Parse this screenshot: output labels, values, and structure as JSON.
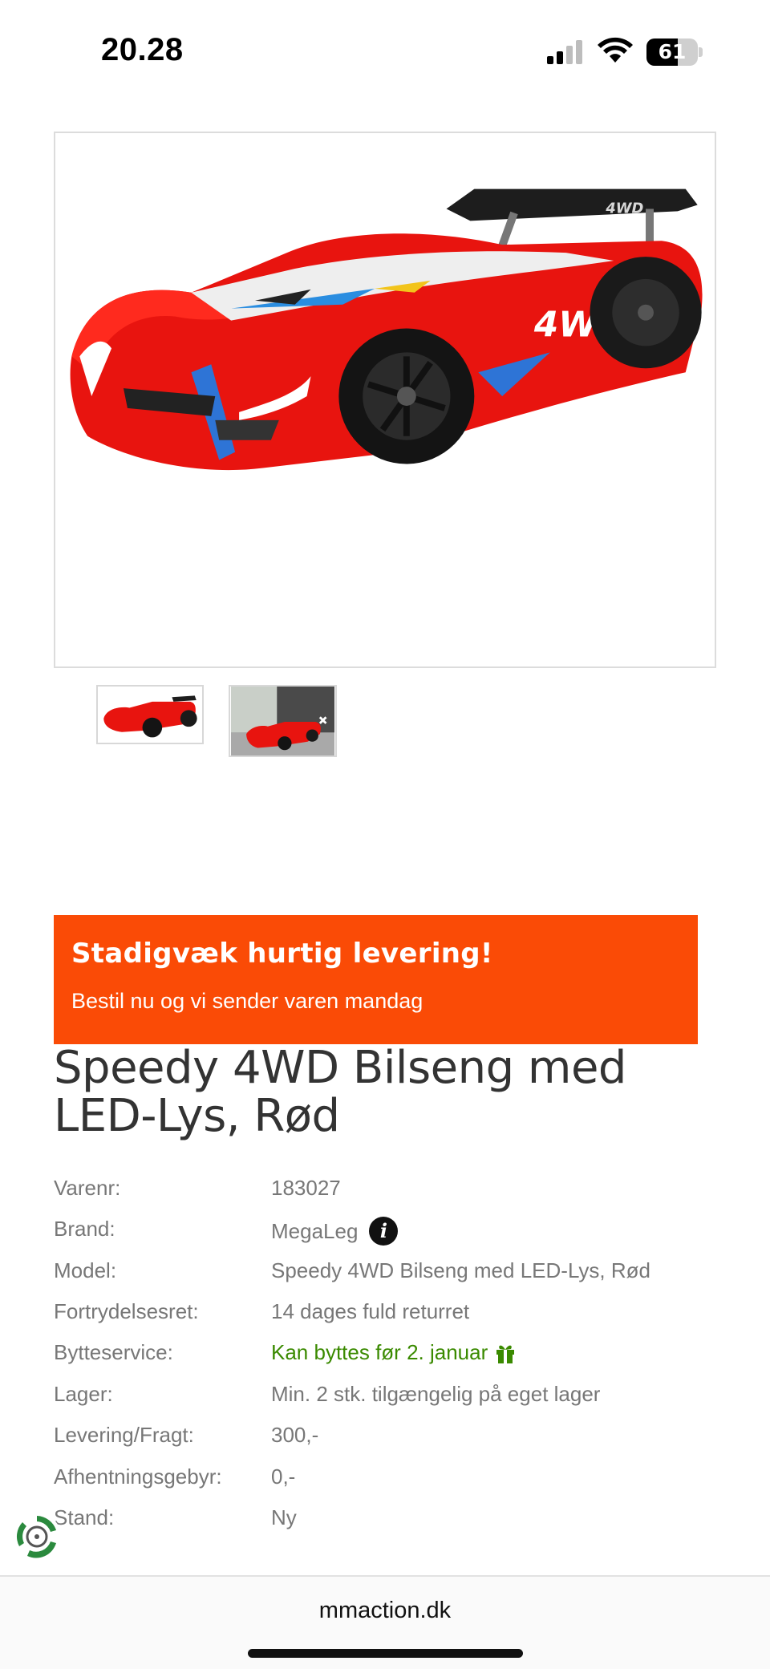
{
  "status_bar": {
    "time": "20.28",
    "battery_level": 61,
    "battery_label": "61"
  },
  "gallery": {
    "main_image_alt": "Speedy 4WD Bilseng med LED-Lys, Rød",
    "car_badge_text": "4WD",
    "thumbnails": [
      {
        "name": "thumbnail-1"
      },
      {
        "name": "thumbnail-2"
      }
    ]
  },
  "banner": {
    "title": "Stadigvæk hurtig levering!",
    "subtitle": "Bestil nu og vi sender varen mandag",
    "color": "#fa4b06"
  },
  "product": {
    "title": "Speedy 4WD Bilseng med LED-Lys, Rød",
    "specs": [
      {
        "label": "Varenr:",
        "value": "183027"
      },
      {
        "label": "Brand:",
        "value": "MegaLeg",
        "icon": "info-icon"
      },
      {
        "label": "Model:",
        "value": "Speedy 4WD Bilseng med LED-Lys, Rød"
      },
      {
        "label": "Fortrydelsesret:",
        "value": "14 dages fuld returret"
      },
      {
        "label": "Bytteservice:",
        "value": "Kan byttes før 2. januar",
        "icon": "gift-icon",
        "color": "#3a8a00"
      },
      {
        "label": "Lager:",
        "value": "Min. 2 stk. tilgængelig på eget lager"
      },
      {
        "label": "Levering/Fragt:",
        "value": "300,-"
      },
      {
        "label": "Afhentningsgebyr:",
        "value": "0,-"
      },
      {
        "label": "Stand:",
        "value": "Ny"
      }
    ]
  },
  "browser": {
    "url": "mmaction.dk"
  }
}
